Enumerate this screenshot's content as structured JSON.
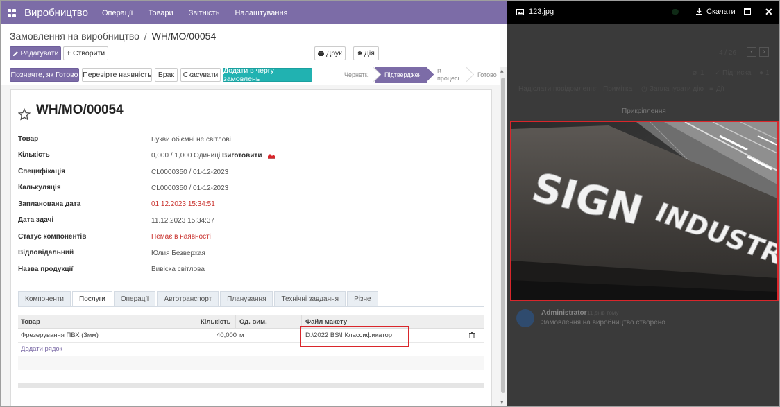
{
  "nav": {
    "brand": "Виробництво",
    "items": [
      "Операції",
      "Товари",
      "Звітність",
      "Налаштування"
    ]
  },
  "breadcrumb": {
    "parent": "Замовлення на виробництво",
    "separator": "/",
    "current": "WH/MO/00054"
  },
  "actions": {
    "edit": "Редагувати",
    "create": "Створити",
    "print": "Друк",
    "action": "Дія"
  },
  "header_buttons": {
    "mark_done": "Позначте, як Готово",
    "check_availability": "Перевірте наявність",
    "scrap": "Брак",
    "cancel": "Скасувати",
    "add_queue": "Додати в чергу замовлень"
  },
  "stages": [
    "Чернетка",
    "Підтверджено",
    "В процесі",
    "Готово"
  ],
  "active_stage_index": 1,
  "record": {
    "title": "WH/MO/00054",
    "fields": [
      {
        "label": "Товар",
        "value": "Букви об'ємні не світлові"
      },
      {
        "label": "Кількість",
        "value": "0,000  /  1,000  Одиниці",
        "strong": "Виготовити"
      },
      {
        "label": "Специфікація",
        "value": "CL0000350 / 01-12-2023"
      },
      {
        "label": "Калькуляція",
        "value": "CL0000350 / 01-12-2023"
      },
      {
        "label": "Запланована дата",
        "value": "01.12.2023 15:34:51"
      },
      {
        "label": "Дата здачі",
        "value": "11.12.2023 15:34:37"
      },
      {
        "label": "Статус компонентів",
        "value": "Немає в наявності"
      },
      {
        "label": "Відповідальний",
        "value": "Юлия Безверхая"
      },
      {
        "label": "Назва продукції",
        "value": "Вивіска світлова"
      }
    ]
  },
  "tabs": [
    "Компоненти",
    "Послуги",
    "Операції",
    "Автотранспорт",
    "Планування",
    "Технічні завдання",
    "Різне"
  ],
  "active_tab_index": 1,
  "services_table": {
    "columns": [
      "Товар",
      "Кількість",
      "Од. вим.",
      "Файл макету"
    ],
    "rows": [
      {
        "product": "Фрезерування ПВХ (3мм)",
        "qty": "40,000",
        "uom": "м",
        "file": "D:\\2022 BS\\! Классификатор"
      }
    ],
    "add_line": "Додати рядок"
  },
  "preview": {
    "filename": "123.jpg",
    "download": "Скачати",
    "pager": "4 / 26",
    "follow": "Підписка",
    "followers": "1",
    "attachments_count": "1",
    "chatter_buttons": [
      "Надіслати повідомлення",
      "Примітка",
      "Запланувати дію",
      "Дії"
    ],
    "attachments_title": "Прикріплення",
    "author": "Administrator",
    "message": "Замовлення на виробництво створено",
    "message_time": "11 днів тому",
    "sign_text_1": "SIGN",
    "sign_text_2": "INDUSTRY"
  },
  "colors": {
    "brand": "#7c6ca7",
    "teal": "#21b2b1",
    "highlight": "#d9262b",
    "red_text": "#c9302c"
  }
}
